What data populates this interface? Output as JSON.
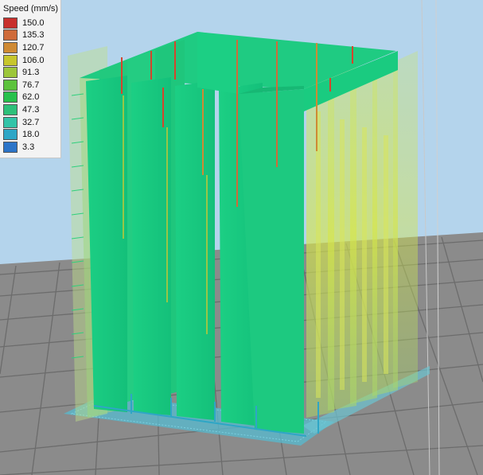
{
  "legend": {
    "title": "Speed (mm/s)",
    "entries": [
      {
        "label": "150.0",
        "color": "#c8302c"
      },
      {
        "label": "135.3",
        "color": "#cf6b3a"
      },
      {
        "label": "120.7",
        "color": "#cf8a33"
      },
      {
        "label": "106.0",
        "color": "#c7c62c"
      },
      {
        "label": "91.3",
        "color": "#9cc63a"
      },
      {
        "label": "76.7",
        "color": "#5cc23c"
      },
      {
        "label": "62.0",
        "color": "#27c04c"
      },
      {
        "label": "47.3",
        "color": "#2ec07a"
      },
      {
        "label": "32.7",
        "color": "#33c4a8"
      },
      {
        "label": "18.0",
        "color": "#2ea6c6"
      },
      {
        "label": "3.3",
        "color": "#2c74c8"
      }
    ]
  },
  "scene": {
    "background_color": "#b4d4ec",
    "bed_color": "#8a8a8a",
    "grid_color": "#6e6e6e",
    "model_color": "#1fcf84",
    "infill_color": "#a8d86a"
  }
}
